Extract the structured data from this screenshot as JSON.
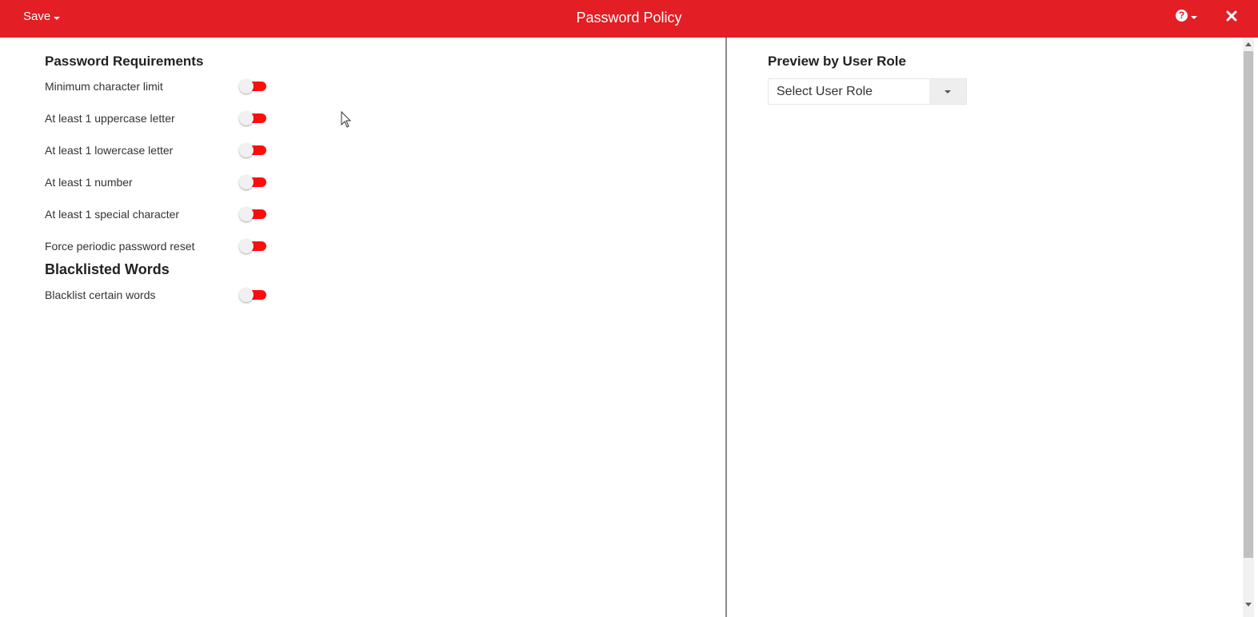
{
  "header": {
    "save_label": "Save",
    "title": "Password Policy",
    "help_icon": "question-circle-icon",
    "close_icon": "close-x-icon",
    "bar_color": "#e31e24"
  },
  "requirements": {
    "heading": "Password Requirements",
    "items": [
      {
        "label": "Minimum character limit"
      },
      {
        "label": "At least 1 uppercase letter"
      },
      {
        "label": "At least 1 lowercase letter"
      },
      {
        "label": "At least 1 number"
      },
      {
        "label": "At least 1 special character"
      },
      {
        "label": "Force periodic password reset"
      }
    ]
  },
  "blacklist": {
    "heading": "Blacklisted Words",
    "items": [
      {
        "label": "Blacklist certain words"
      }
    ]
  },
  "preview": {
    "heading": "Preview by User Role",
    "select_value": "Select User Role"
  },
  "toggle_color": "#ff0d0d"
}
